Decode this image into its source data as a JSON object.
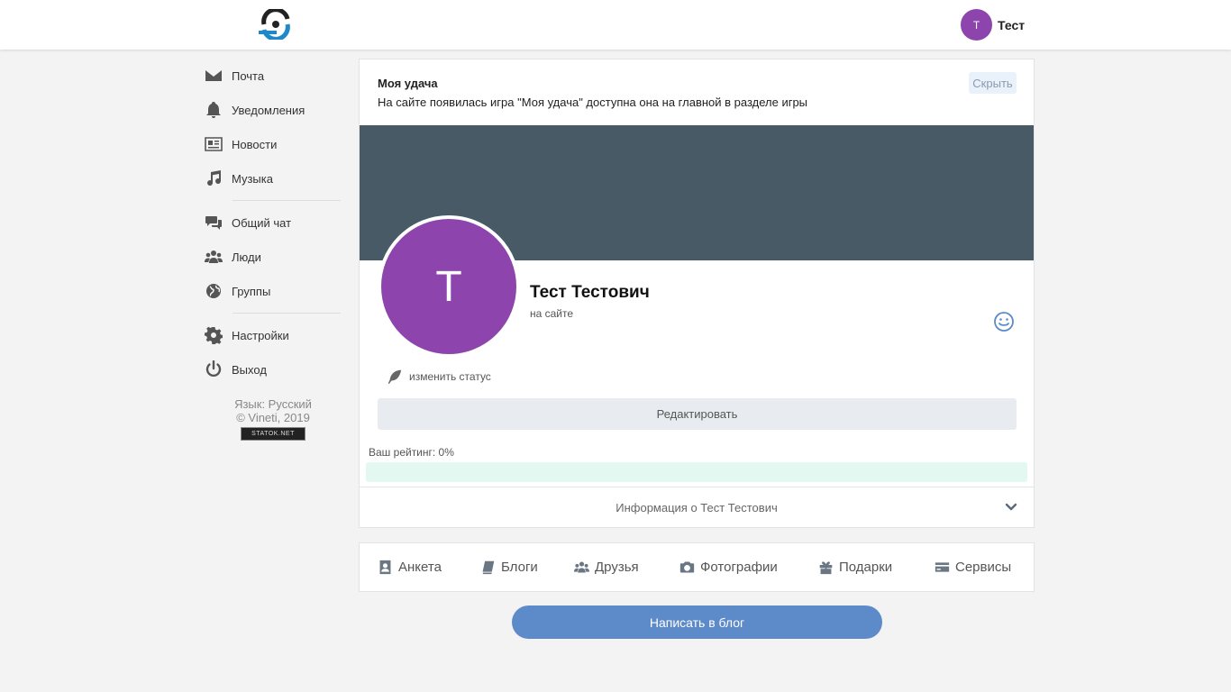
{
  "header": {
    "user": {
      "initial": "Т",
      "name": "Тест"
    }
  },
  "colors": {
    "avatar": "#8e44ad",
    "cover": "#475a66",
    "primary_button": "#5d8bc9"
  },
  "sidebar": {
    "items": [
      {
        "label": "Почта",
        "icon": "envelope-icon"
      },
      {
        "label": "Уведомления",
        "icon": "bell-icon"
      },
      {
        "label": "Новости",
        "icon": "newspaper-icon"
      },
      {
        "label": "Музыка",
        "icon": "music-note-icon"
      },
      {
        "label": "Общий чат",
        "icon": "chat-bubbles-icon"
      },
      {
        "label": "Люди",
        "icon": "people-icon"
      },
      {
        "label": "Группы",
        "icon": "globe-icon"
      },
      {
        "label": "Настройки",
        "icon": "gear-icon"
      },
      {
        "label": "Выход",
        "icon": "power-icon"
      }
    ],
    "footer": {
      "language": "Язык: Русский",
      "copyright": "© Vineti, 2019",
      "counter": "STATOK.NET"
    }
  },
  "notice": {
    "title": "Моя удача",
    "text": "На сайте появилась игра \"Моя удача\" доступна она на главной в разделе игры",
    "hide_label": "Скрыть"
  },
  "profile": {
    "initial": "Т",
    "name": "Тест Тестович",
    "online_status": "на сайте",
    "change_status_label": "изменить статус",
    "edit_label": "Редактировать",
    "rating_label": "Ваш рейтинг: 0%",
    "rating_value": 0,
    "info_label": "Информация о Тест Тестович"
  },
  "tabs": [
    {
      "label": "Анкета",
      "icon": "profile-card-icon"
    },
    {
      "label": "Блоги",
      "icon": "book-icon"
    },
    {
      "label": "Друзья",
      "icon": "friends-icon"
    },
    {
      "label": "Фотографии",
      "icon": "camera-icon"
    },
    {
      "label": "Подарки",
      "icon": "gift-icon"
    },
    {
      "label": "Сервисы",
      "icon": "credit-card-icon"
    }
  ],
  "write_blog_label": "Написать в блог"
}
